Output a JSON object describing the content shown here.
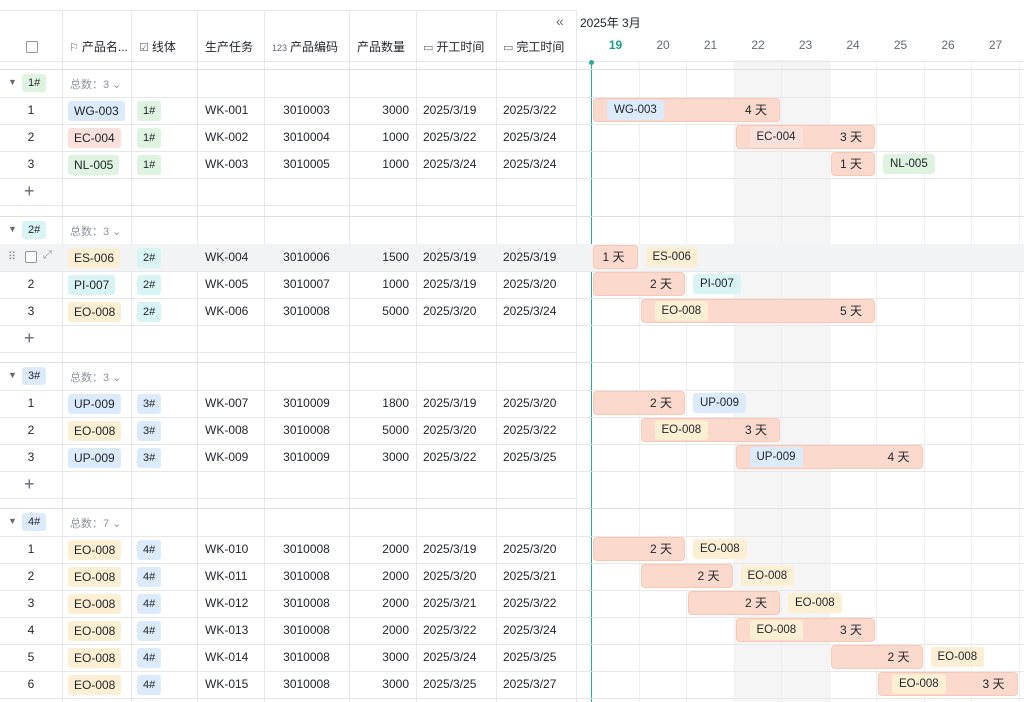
{
  "colors": {
    "tag_blue_bg": "#dcebfc",
    "tag_red_bg": "#fbe0dc",
    "tag_green_bg": "#def4e1",
    "tag_yellow_bg": "#fdefd4",
    "tag_cyan_bg": "#d9f4f4",
    "bar_bg": "#fcd9cd",
    "today": "#16a085"
  },
  "header": {
    "collapse_icon": "double-chevron-left-icon",
    "month": "2025年 3月",
    "columns": [
      {
        "label": "产品名...",
        "icon": "flag-icon"
      },
      {
        "label": "线体",
        "icon": "checkbox-icon"
      },
      {
        "label": "生产任务"
      },
      {
        "label": "产品编码",
        "icon": "number-123-icon"
      },
      {
        "label": "产品数量"
      },
      {
        "label": "开工时间",
        "icon": "calendar-icon"
      },
      {
        "label": "完工时间",
        "icon": "calendar-icon"
      }
    ],
    "days": [
      "19",
      "20",
      "21",
      "22",
      "23",
      "24",
      "25",
      "26",
      "27"
    ]
  },
  "groups": [
    {
      "label": "1#",
      "color": "tag_green_bg",
      "count_text": "总数：3",
      "rows": [
        {
          "idx": "1",
          "name": "WG-003",
          "name_color": "tag_blue_bg",
          "line": "1#",
          "task": "WK-001",
          "code": "3010003",
          "qty": "3000",
          "start": "2025/3/19",
          "end": "2025/3/22",
          "dur": "4 天"
        },
        {
          "idx": "2",
          "name": "EC-004",
          "name_color": "tag_red_bg",
          "line": "1#",
          "task": "WK-002",
          "code": "3010004",
          "qty": "1000",
          "start": "2025/3/22",
          "end": "2025/3/24",
          "dur": "3 天"
        },
        {
          "idx": "3",
          "name": "NL-005",
          "name_color": "tag_green_bg",
          "line": "1#",
          "task": "WK-003",
          "code": "3010005",
          "qty": "1000",
          "start": "2025/3/24",
          "end": "2025/3/24",
          "dur": "1 天"
        }
      ]
    },
    {
      "label": "2#",
      "color": "tag_cyan_bg",
      "count_text": "总数：3",
      "rows": [
        {
          "idx": "",
          "name": "ES-006",
          "name_color": "tag_yellow_bg",
          "line": "2#",
          "task": "WK-004",
          "code": "3010006",
          "qty": "1500",
          "start": "2025/3/19",
          "end": "2025/3/19",
          "dur": "1 天",
          "hover": true
        },
        {
          "idx": "2",
          "name": "PI-007",
          "name_color": "tag_cyan_bg",
          "line": "2#",
          "task": "WK-005",
          "code": "3010007",
          "qty": "1000",
          "start": "2025/3/19",
          "end": "2025/3/20",
          "dur": "2 天"
        },
        {
          "idx": "3",
          "name": "EO-008",
          "name_color": "tag_yellow_bg",
          "line": "2#",
          "task": "WK-006",
          "code": "3010008",
          "qty": "5000",
          "start": "2025/3/20",
          "end": "2025/3/24",
          "dur": "5 天"
        }
      ]
    },
    {
      "label": "3#",
      "color": "tag_blue_bg",
      "count_text": "总数：3",
      "rows": [
        {
          "idx": "1",
          "name": "UP-009",
          "name_color": "tag_blue_bg",
          "line": "3#",
          "task": "WK-007",
          "code": "3010009",
          "qty": "1800",
          "start": "2025/3/19",
          "end": "2025/3/20",
          "dur": "2 天"
        },
        {
          "idx": "2",
          "name": "EO-008",
          "name_color": "tag_yellow_bg",
          "line": "3#",
          "task": "WK-008",
          "code": "3010008",
          "qty": "5000",
          "start": "2025/3/20",
          "end": "2025/3/22",
          "dur": "3 天"
        },
        {
          "idx": "3",
          "name": "UP-009",
          "name_color": "tag_blue_bg",
          "line": "3#",
          "task": "WK-009",
          "code": "3010009",
          "qty": "3000",
          "start": "2025/3/22",
          "end": "2025/3/25",
          "dur": "4 天"
        }
      ]
    },
    {
      "label": "4#",
      "color": "tag_blue_bg",
      "count_text": "总数：7",
      "rows": [
        {
          "idx": "1",
          "name": "EO-008",
          "name_color": "tag_yellow_bg",
          "line": "4#",
          "task": "WK-010",
          "code": "3010008",
          "qty": "2000",
          "start": "2025/3/19",
          "end": "2025/3/20",
          "dur": "2 天"
        },
        {
          "idx": "2",
          "name": "EO-008",
          "name_color": "tag_yellow_bg",
          "line": "4#",
          "task": "WK-011",
          "code": "3010008",
          "qty": "2000",
          "start": "2025/3/20",
          "end": "2025/3/21",
          "dur": "2 天"
        },
        {
          "idx": "3",
          "name": "EO-008",
          "name_color": "tag_yellow_bg",
          "line": "4#",
          "task": "WK-012",
          "code": "3010008",
          "qty": "2000",
          "start": "2025/3/21",
          "end": "2025/3/22",
          "dur": "2 天"
        },
        {
          "idx": "4",
          "name": "EO-008",
          "name_color": "tag_yellow_bg",
          "line": "4#",
          "task": "WK-013",
          "code": "3010008",
          "qty": "2000",
          "start": "2025/3/22",
          "end": "2025/3/24",
          "dur": "3 天"
        },
        {
          "idx": "5",
          "name": "EO-008",
          "name_color": "tag_yellow_bg",
          "line": "4#",
          "task": "WK-014",
          "code": "3010008",
          "qty": "3000",
          "start": "2025/3/24",
          "end": "2025/3/25",
          "dur": "2 天"
        },
        {
          "idx": "6",
          "name": "EO-008",
          "name_color": "tag_yellow_bg",
          "line": "4#",
          "task": "WK-015",
          "code": "3010008",
          "qty": "3000",
          "start": "2025/3/25",
          "end": "2025/3/27",
          "dur": "3 天"
        }
      ]
    }
  ]
}
